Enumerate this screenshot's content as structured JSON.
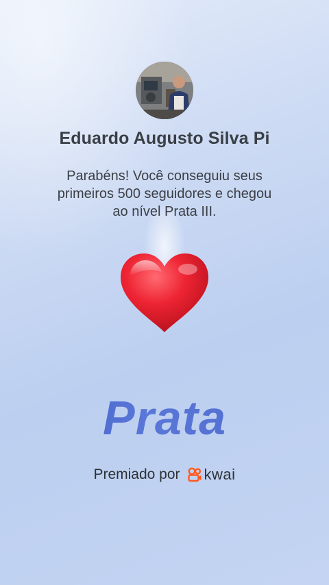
{
  "profile": {
    "name": "Eduardo Augusto Silva Pi",
    "avatar_icon": "user-photo"
  },
  "message": {
    "lines": [
      "Parabéns! Você conseguiu seus",
      "primeiros 500 seguidores e chegou",
      "ao nível Prata III."
    ]
  },
  "badge": {
    "icon": "heart-icon",
    "color": "#e8202e"
  },
  "level": {
    "title": "Prata",
    "color": "#4a5fc8"
  },
  "award": {
    "label": "Premiado por",
    "brand_icon": "kwai-logo-icon",
    "brand_name": "kwai",
    "brand_color": "#ff5a1f"
  }
}
